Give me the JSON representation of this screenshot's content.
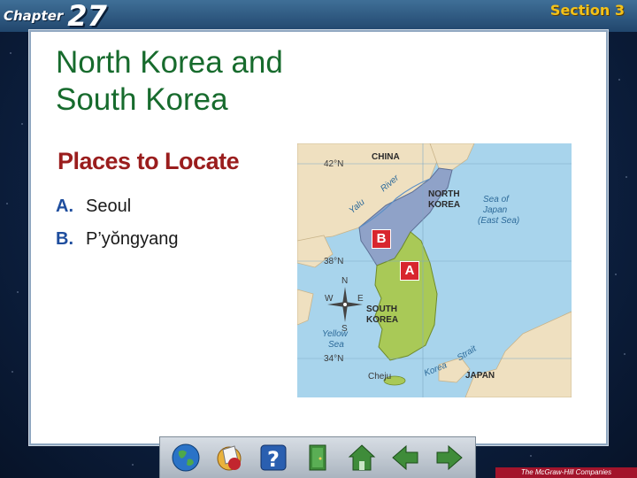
{
  "header": {
    "chapter_word": "Chapter",
    "chapter_number": "27",
    "section": "Section 3"
  },
  "slide": {
    "title_line1": "North Korea and",
    "title_line2": "South Korea",
    "subhead": "Places to Locate",
    "items": [
      {
        "letter": "A.",
        "text": "Seoul"
      },
      {
        "letter": "B.",
        "text": "P’yŏngyang"
      }
    ]
  },
  "map": {
    "lat_labels": [
      "42°N",
      "38°N",
      "34°N"
    ],
    "countries": [
      "CHINA",
      "NORTH",
      "KOREA",
      "SOUTH",
      "KOREA",
      "JAPAN"
    ],
    "water": {
      "yalu_1": "Yalu",
      "yalu_2": "River",
      "sea_of_japan_1": "Sea of",
      "sea_of_japan_2": "Japan",
      "sea_of_japan_3": "(East Sea)",
      "yellow_sea_1": "Yellow",
      "yellow_sea_2": "Sea",
      "korea_strait_1": "Korea",
      "korea_strait_2": "Strait",
      "cheju": "Cheju"
    },
    "compass": {
      "n": "N",
      "s": "S",
      "e": "E",
      "w": "W"
    },
    "markers": {
      "a": "A",
      "b": "B"
    },
    "colors": {
      "sea": "#a8d4ec",
      "north_korea": "#8fa2c8",
      "south_korea": "#a9c957",
      "land": "#efe0c0",
      "marker": "#d8262e"
    }
  },
  "nav": {
    "buttons": [
      "globe-icon",
      "resources-icon",
      "help-icon",
      "exit-icon",
      "home-icon",
      "back-arrow-icon",
      "forward-arrow-icon"
    ]
  },
  "footer": {
    "publisher": "The McGraw-Hill Companies"
  }
}
